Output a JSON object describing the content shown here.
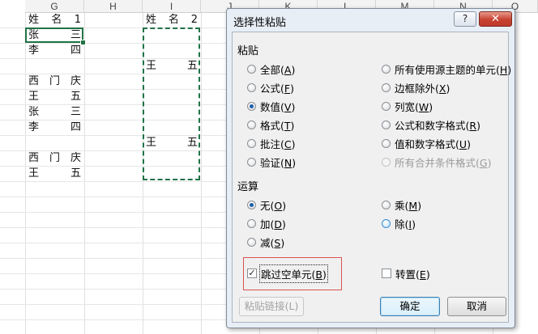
{
  "sheet": {
    "columns": [
      "G",
      "H",
      "I",
      "J",
      "K",
      "L",
      "M",
      "N",
      "O"
    ],
    "colG": [
      {
        "chars": [
          "姓",
          "名",
          "1"
        ]
      },
      {
        "chars": [
          "张",
          "三"
        ]
      },
      {
        "chars": [
          "李",
          "四"
        ]
      },
      {
        "chars": []
      },
      {
        "chars": [
          "西",
          "门",
          "庆"
        ]
      },
      {
        "chars": [
          "王",
          "五"
        ]
      },
      {
        "chars": [
          "张",
          "三"
        ]
      },
      {
        "chars": [
          "李",
          "四"
        ]
      },
      {
        "chars": []
      },
      {
        "chars": [
          "西",
          "门",
          "庆"
        ]
      },
      {
        "chars": [
          "王",
          "五"
        ]
      }
    ],
    "colI": [
      {
        "chars": [
          "姓",
          "名",
          "2"
        ]
      },
      {
        "chars": []
      },
      {
        "chars": []
      },
      {
        "chars": [
          "王",
          "五"
        ]
      },
      {
        "chars": []
      },
      {
        "chars": []
      },
      {
        "chars": []
      },
      {
        "chars": []
      },
      {
        "chars": [
          "王",
          "五"
        ]
      }
    ]
  },
  "dialog": {
    "title": "选择性粘贴",
    "help": "?",
    "close": "✕",
    "paste_section": "粘贴",
    "paste_left": [
      {
        "label": "全部",
        "key": "A",
        "checked": false
      },
      {
        "label": "公式",
        "key": "F",
        "checked": false
      },
      {
        "label": "数值",
        "key": "V",
        "checked": true
      },
      {
        "label": "格式",
        "key": "T",
        "checked": false
      },
      {
        "label": "批注",
        "key": "C",
        "checked": false
      },
      {
        "label": "验证",
        "key": "N",
        "checked": false
      }
    ],
    "paste_right": [
      {
        "label": "所有使用源主题的单元",
        "key": "H",
        "checked": false,
        "disabled": false
      },
      {
        "label": "边框除外",
        "key": "X",
        "checked": false,
        "disabled": false
      },
      {
        "label": "列宽",
        "key": "W",
        "checked": false,
        "disabled": false
      },
      {
        "label": "公式和数字格式",
        "key": "R",
        "checked": false,
        "disabled": false
      },
      {
        "label": "值和数字格式",
        "key": "U",
        "checked": false,
        "disabled": false
      },
      {
        "label": "所有合并条件格式",
        "key": "G",
        "checked": false,
        "disabled": true
      }
    ],
    "op_section": "运算",
    "op_left": [
      {
        "label": "无",
        "key": "O",
        "checked": true
      },
      {
        "label": "加",
        "key": "D",
        "checked": false
      },
      {
        "label": "减",
        "key": "S",
        "checked": false
      }
    ],
    "op_right": [
      {
        "label": "乘",
        "key": "M",
        "checked": false
      },
      {
        "label": "除",
        "key": "I",
        "checked": false
      }
    ],
    "skip_blanks": {
      "label": "跳过空单元",
      "key": "B",
      "checked": true
    },
    "transpose": {
      "label": "转置",
      "key": "E",
      "checked": false
    },
    "paste_link": "粘贴链接(L)",
    "ok": "确定",
    "cancel": "取消"
  }
}
